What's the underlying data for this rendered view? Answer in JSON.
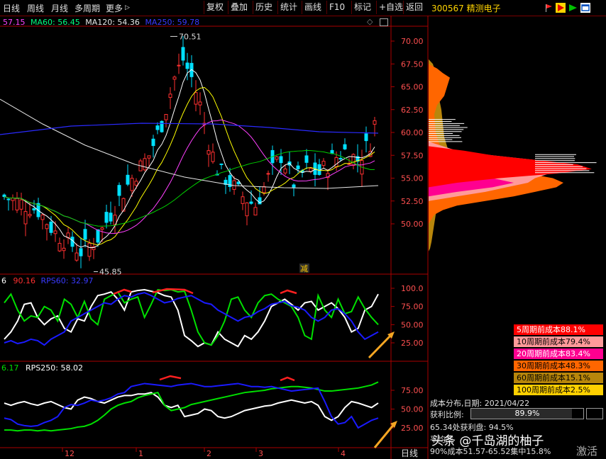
{
  "toolbar": {
    "periods": [
      "日线",
      "周线",
      "月线",
      "多周期",
      "更多"
    ],
    "more_arrow": "▷",
    "buttons": [
      "复权",
      "叠加",
      "历史",
      "统计",
      "画线",
      "F10",
      "标记",
      "+自选",
      "返回"
    ]
  },
  "stock": {
    "code": "300567",
    "name": "精测电子"
  },
  "main_legend": {
    "ma_a": "57.15",
    "ma60": "MA60: 56.45",
    "ma120": "MA120: 54.36",
    "ma250": "MA250: 59.78"
  },
  "main_annotations": {
    "high": "70.51",
    "low": "45.85",
    "marker": "减"
  },
  "price_axis": [
    "70.00",
    "67.50",
    "65.00",
    "62.50",
    "60.00",
    "57.50",
    "55.00",
    "52.50",
    "50.00"
  ],
  "rps1": {
    "prefix": "6",
    "value": "90.16",
    "label": "RPS60: 32.97",
    "axis": [
      "100.0",
      "75.00",
      "50.00",
      "25.00"
    ]
  },
  "rps2": {
    "prefix": "6.17",
    "label": "RPS250: 58.02",
    "axis": [
      "75.00",
      "50.00",
      "25.00"
    ]
  },
  "x_axis": {
    "labels": [
      "12",
      "1",
      "2",
      "3",
      "4"
    ],
    "period": "日线"
  },
  "cost_legend": [
    {
      "text": "5周期前成本88.1%",
      "color": "#ff0000",
      "fg": "#ffffff"
    },
    {
      "text": "10周期前成本79.4%",
      "color": "#ff9a9a",
      "fg": "#000000"
    },
    {
      "text": "20周期前成本83.4%",
      "color": "#ff0090",
      "fg": "#ffffff"
    },
    {
      "text": "30周期前成本48.3%",
      "color": "#ff6600",
      "fg": "#000000"
    },
    {
      "text": "60周期前成本15.1%",
      "color": "#b8860b",
      "fg": "#000000"
    },
    {
      "text": "100周期前成本2.5%",
      "color": "#ffd000",
      "fg": "#000000"
    }
  ],
  "cost_info": {
    "date_line": "成本分布,日期: 2021/04/22",
    "profit_label": "获利比例:",
    "profit_value": "89.9%",
    "profit_fraction": 0.899,
    "line3": "65.34处获利盘: 94.5%",
    "line4": "平均成",
    "line5": "90%成本51.57-65.52集中15.8%"
  },
  "watermark": {
    "text": "头条 @千岛湖的柚子",
    "corner": "激活"
  },
  "colors": {
    "up": "#ff3030",
    "down": "#00e0ff",
    "rps_green": "#00e000",
    "rps_blue": "#1a1aff",
    "axis_red": "#aa0000"
  }
}
